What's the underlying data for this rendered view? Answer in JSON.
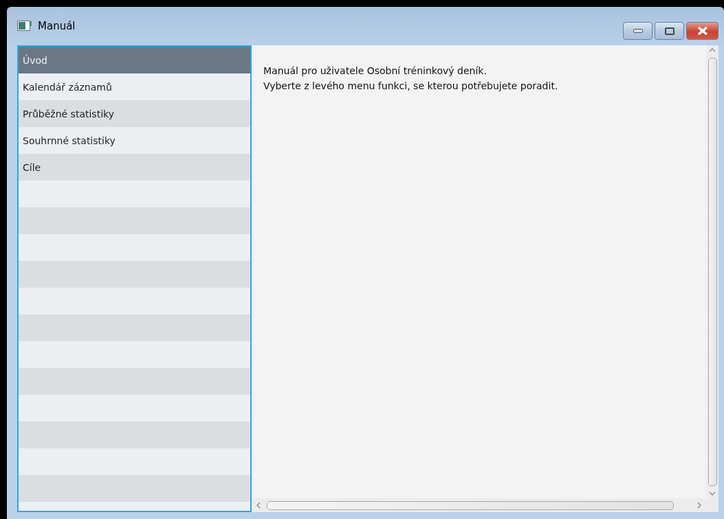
{
  "window": {
    "title": "Manuál"
  },
  "sidebar": {
    "items": [
      {
        "label": "Úvod",
        "selected": true
      },
      {
        "label": "Kalendář záznamů",
        "selected": false
      },
      {
        "label": "Průběžné statistiky",
        "selected": false
      },
      {
        "label": "Souhrnné statistiky",
        "selected": false
      },
      {
        "label": "Cíle",
        "selected": false
      }
    ]
  },
  "content": {
    "lines": [
      "Manuál pro uživatele Osobní tréninkový deník.",
      "Vyberte z levého menu funkci, se kterou potřebujete poradit."
    ]
  }
}
